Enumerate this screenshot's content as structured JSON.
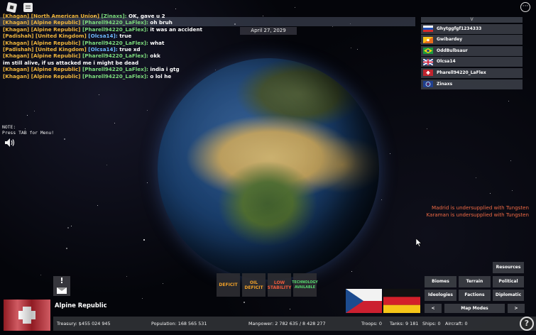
{
  "chat": {
    "messages": [
      {
        "tag": "[Khagan] [North American Union] ",
        "name": "[Zinaxs]:",
        "name_color": "green",
        "text": " OK, gave u 2"
      },
      {
        "tag": "[Khagan] [Alpine Republic] ",
        "name": "[Pharell94220_LaFlex]:",
        "name_color": "green",
        "text": " oh bruh"
      },
      {
        "tag": "[Khagan] [Alpine Republic] ",
        "name": "[Pharell94220_LaFlex]:",
        "name_color": "green",
        "text": " it was an accident"
      },
      {
        "tag": "[Padishah] [United Kingdom] ",
        "name": "[Olcsa14]:",
        "name_color": "blue",
        "text": " true"
      },
      {
        "tag": "[Khagan] [Alpine Republic] ",
        "name": "[Pharell94220_LaFlex]:",
        "name_color": "green",
        "text": " what"
      },
      {
        "tag": "[Padishah] [United Kingdom] ",
        "name": "[Olcsa14]:",
        "name_color": "blue",
        "text": " true xd"
      },
      {
        "tag": "[Khagan] [Alpine Republic] ",
        "name": "[Pharell94220_LaFlex]:",
        "name_color": "green",
        "text": " okk im still alive, if us attacked me i might be dead"
      },
      {
        "tag": "[Khagan] [Alpine Republic] ",
        "name": "[Pharell94220_LaFlex]:",
        "name_color": "green",
        "text": " india i gtg"
      },
      {
        "tag": "[Khagan] [Alpine Republic] ",
        "name": "[Pharell94220_LaFlex]:",
        "name_color": "green",
        "text": " o lol he"
      }
    ]
  },
  "date": "April 27, 2029",
  "note": {
    "line1": "NOTE:",
    "line2": "Press TAB for Menu!"
  },
  "players": {
    "header": "V",
    "list": [
      {
        "name": "Ghytggfgf1234333",
        "flag": "russia"
      },
      {
        "name": "Gwibardey",
        "flag": "bhutan"
      },
      {
        "name": "OddBulbsaur",
        "flag": "brazil"
      },
      {
        "name": "Olcsa14",
        "flag": "united-kingdom"
      },
      {
        "name": "Pharell94220_LaFlex",
        "flag": "alpine-republic"
      },
      {
        "name": "Zinaxs",
        "flag": "north-american-union"
      }
    ]
  },
  "notifications": [
    "Madrid is undersupplied with Tungsten",
    "Karaman is undersupplied with Tungsten"
  ],
  "status_buttons": {
    "deficit": "DEFICIT",
    "oil_deficit": "OIL DEFICIT",
    "low_stability": "LOW STABILITY",
    "technology": "TECHNOLOGY AVAILABLE"
  },
  "mail": {
    "badge": "!"
  },
  "country": {
    "name": "Alpine Republic"
  },
  "menu": {
    "resources": "Resources",
    "biomes": "Biomes",
    "terrain": "Terrain",
    "political": "Political",
    "ideologies": "Ideologies",
    "factions": "Factions",
    "diplomatic": "Diplomatic",
    "prev": "<",
    "map_modes": "Map Modes",
    "next": ">"
  },
  "stats": {
    "treasury": "Treasury:  $455 024 945",
    "population": "Population: 168 565 531",
    "manpower": "Manpower:  2 782 635  /  8 428 277",
    "troops": "Troops: 0",
    "tanks": "Tanks: 9 181",
    "ships": "Ships: 0",
    "aircraft": "Aircraft: 0"
  },
  "help": "?",
  "more": "···",
  "colors": {
    "tag": "#f0b63c",
    "name_green": "#7ddc7d",
    "name_blue": "#6fb8ff",
    "warning": "#f06a45",
    "deficit": "#f0a028",
    "tech": "#56d66f"
  }
}
